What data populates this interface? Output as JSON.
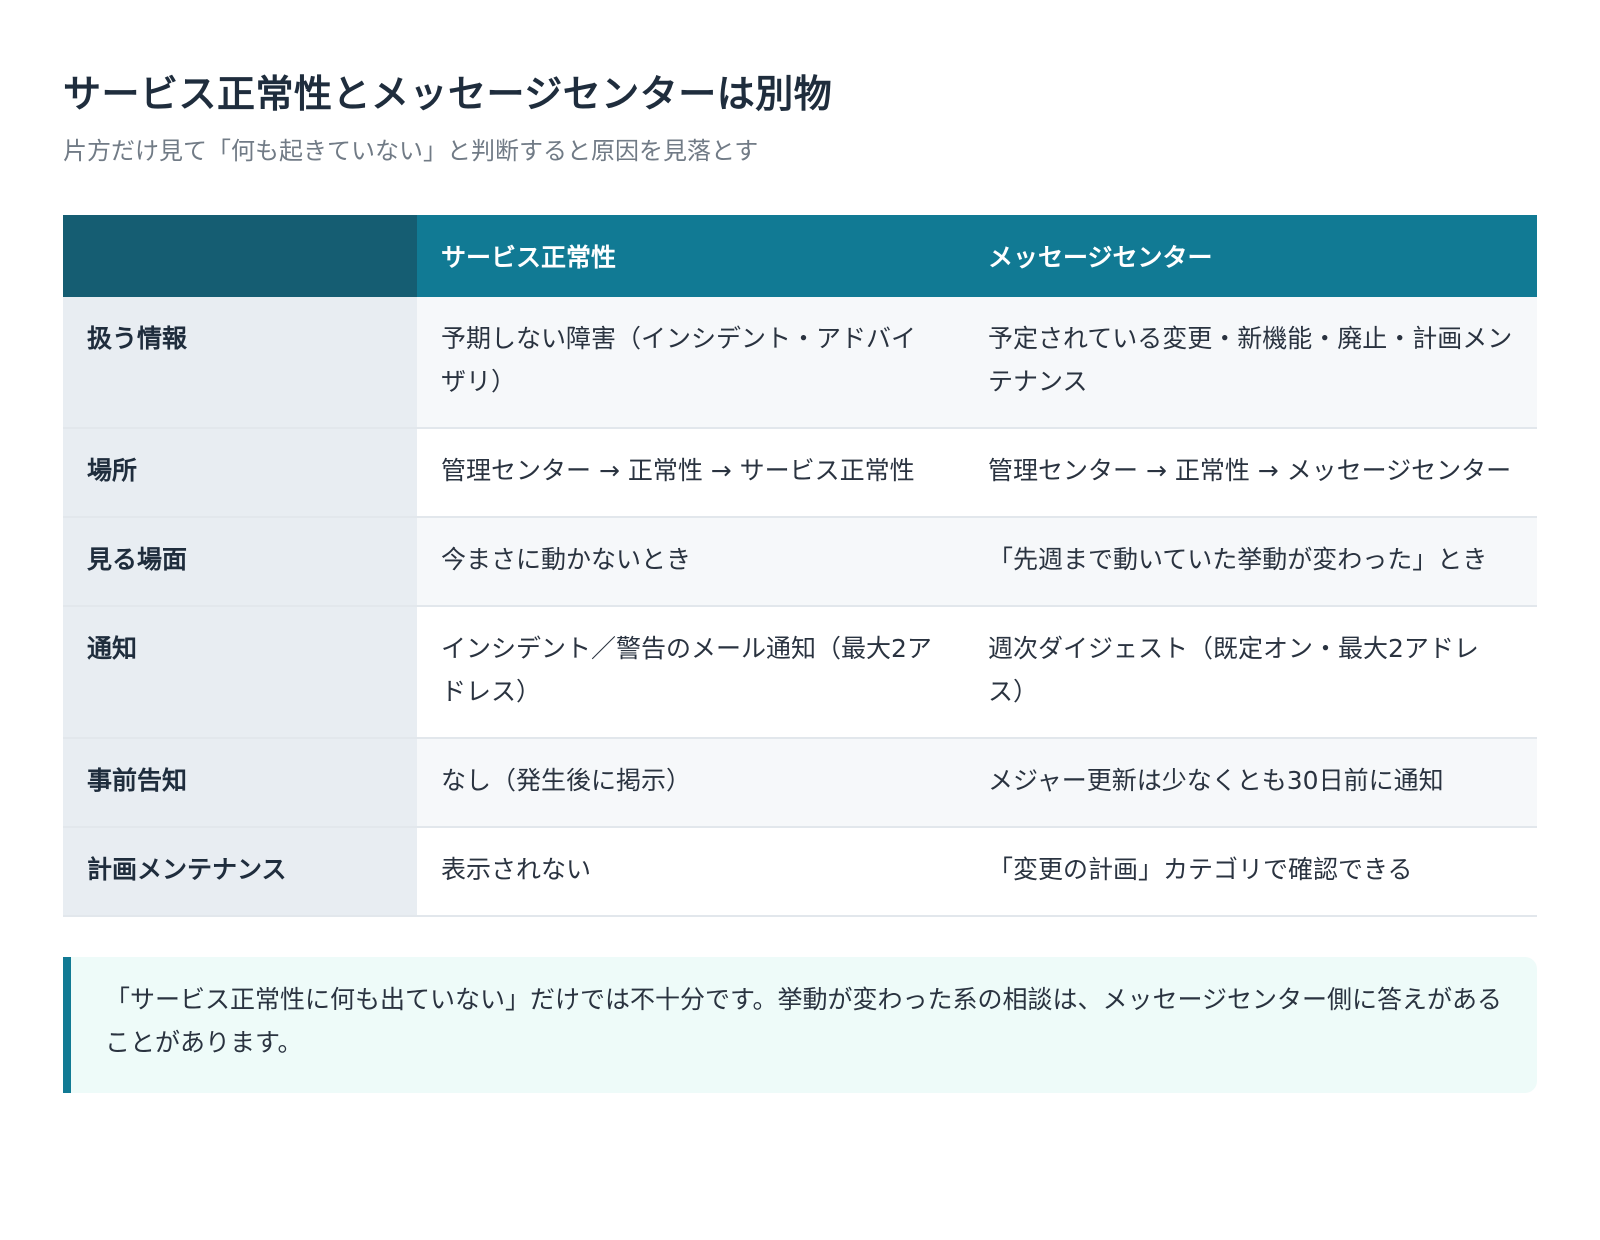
{
  "title": "サービス正常性とメッセージセンターは別物",
  "subtitle": "片方だけ見て「何も起きていない」と判断すると原因を見落とす",
  "table": {
    "headers": [
      "",
      "サービス正常性",
      "メッセージセンター"
    ],
    "rows": [
      {
        "label": "扱う情報",
        "health": "予期しない障害（インシデント・アドバイザリ）",
        "message": "予定されている変更・新機能・廃止・計画メンテナンス"
      },
      {
        "label": "場所",
        "health": "管理センター → 正常性 → サービス正常性",
        "message": "管理センター → 正常性 → メッセージセンター"
      },
      {
        "label": "見る場面",
        "health": "今まさに動かないとき",
        "message": "「先週まで動いていた挙動が変わった」とき"
      },
      {
        "label": "通知",
        "health": "インシデント／警告のメール通知（最大2アドレス）",
        "message": "週次ダイジェスト（既定オン・最大2アドレス）"
      },
      {
        "label": "事前告知",
        "health": "なし（発生後に掲示）",
        "message": "メジャー更新は少なくとも30日前に通知"
      },
      {
        "label": "計画メンテナンス",
        "health": "表示されない",
        "message": "「変更の計画」カテゴリで確認できる"
      }
    ]
  },
  "note": "「サービス正常性に何も出ていない」だけでは不十分です。挙動が変わった系の相談は、メッセージセンター側に答えがあることがあります。",
  "colors": {
    "header": "#117a94",
    "header_corner": "#155d72",
    "row_label_bg": "#e8edf2",
    "note_bg": "#eefbf9",
    "note_border": "#117a94"
  }
}
